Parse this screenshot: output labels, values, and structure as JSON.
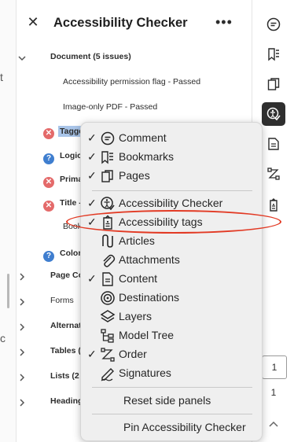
{
  "panel": {
    "title": "Accessibility Checker",
    "close_icon": "close-icon",
    "more_icon": "more-options-icon"
  },
  "tree": {
    "document_label": "Document (5 issues)",
    "items": [
      {
        "label": "Accessibility permission flag - Passed"
      },
      {
        "label": "Image-only PDF - Passed"
      }
    ],
    "row_tagged": "Tagge",
    "row_logical": "Logica",
    "row_primary": "Prima",
    "row_title": "Title -",
    "row_bookmarks": "Bookm",
    "row_color": "Color",
    "page_content": "Page Con",
    "forms": "Forms",
    "alternate": "Alternat",
    "tables": "Tables (4",
    "lists": "Lists (2 i",
    "headings": "Heading"
  },
  "menu": {
    "items": [
      {
        "label": "Comment",
        "checked": true,
        "icon": "comment-icon"
      },
      {
        "label": "Bookmarks",
        "checked": true,
        "icon": "bookmarks-icon"
      },
      {
        "label": "Pages",
        "checked": true,
        "icon": "pages-icon"
      },
      {
        "label": "Accessibility Checker",
        "checked": true,
        "icon": "accessibility-checker-icon"
      },
      {
        "label": "Accessibility tags",
        "checked": true,
        "icon": "accessibility-tags-icon"
      },
      {
        "label": "Articles",
        "checked": false,
        "icon": "articles-icon"
      },
      {
        "label": "Attachments",
        "checked": false,
        "icon": "attachments-icon"
      },
      {
        "label": "Content",
        "checked": true,
        "icon": "content-icon"
      },
      {
        "label": "Destinations",
        "checked": false,
        "icon": "destinations-icon"
      },
      {
        "label": "Layers",
        "checked": false,
        "icon": "layers-icon"
      },
      {
        "label": "Model Tree",
        "checked": false,
        "icon": "model-tree-icon"
      },
      {
        "label": "Order",
        "checked": true,
        "icon": "order-icon"
      },
      {
        "label": "Signatures",
        "checked": false,
        "icon": "signatures-icon"
      }
    ],
    "reset_label": "Reset side panels",
    "pin_label": "Pin Accessibility Checker",
    "check_glyph": "✓"
  },
  "rail": {
    "page_number": "1",
    "page_total": "1"
  },
  "doc_fragments": {
    "frag1": "t",
    "frag2": "c"
  },
  "colors": {
    "accent_highlight": "#a9c5e9",
    "annotation_red": "#e23a24",
    "active_rail": "#2f2f2f"
  }
}
